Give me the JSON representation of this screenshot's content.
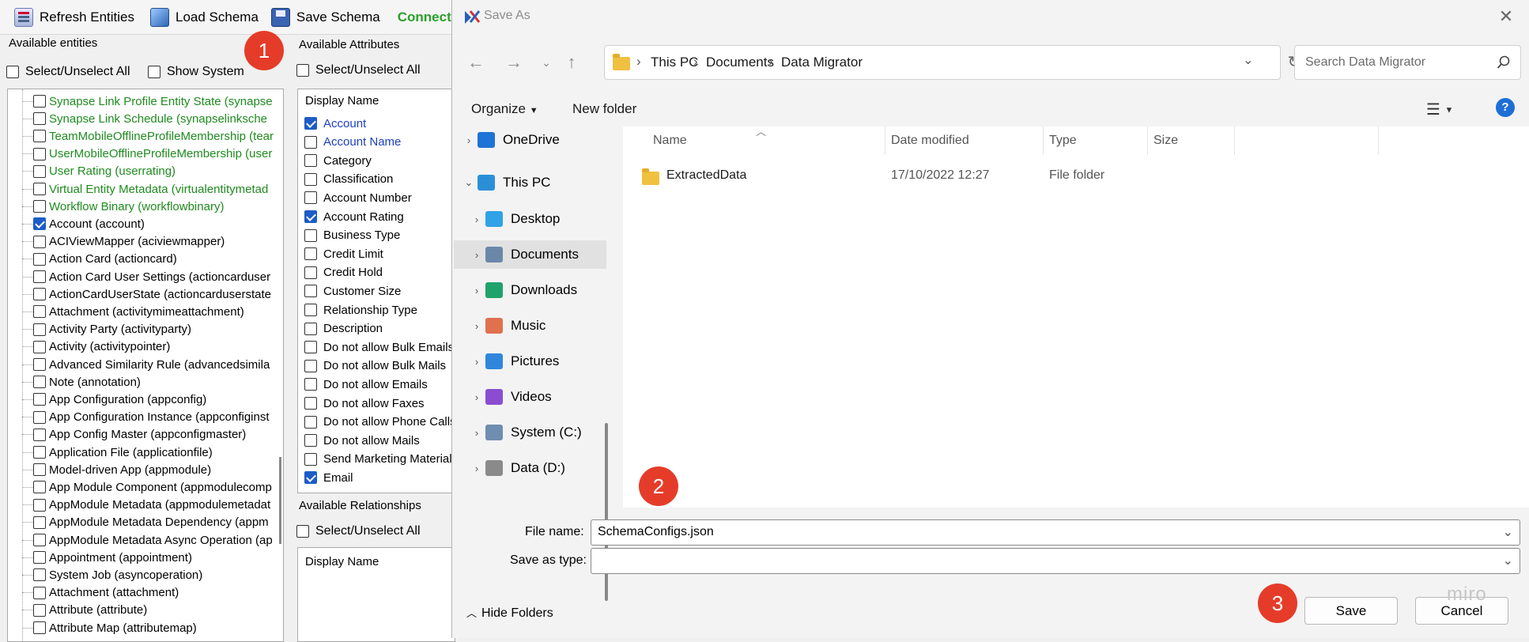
{
  "toolbar": {
    "refresh_label": "Refresh Entities",
    "load_label": "Load Schema",
    "save_label": "Save Schema",
    "status": "Connected"
  },
  "entities": {
    "header": "Available entities",
    "select_all": "Select/Unselect All",
    "show_system": "Show System",
    "items": [
      {
        "label": "Synapse Link Profile Entity State (synapse",
        "green": true,
        "checked": false
      },
      {
        "label": "Synapse Link Schedule (synapselinksche",
        "green": true,
        "checked": false
      },
      {
        "label": "TeamMobileOfflineProfileMembership (tear",
        "green": true,
        "checked": false
      },
      {
        "label": "UserMobileOfflineProfileMembership (user",
        "green": true,
        "checked": false
      },
      {
        "label": "User Rating (userrating)",
        "green": true,
        "checked": false
      },
      {
        "label": "Virtual Entity  Metadata (virtualentitymetad",
        "green": true,
        "checked": false
      },
      {
        "label": "Workflow Binary (workflowbinary)",
        "green": true,
        "checked": false
      },
      {
        "label": "Account (account)",
        "green": false,
        "checked": true
      },
      {
        "label": "ACIViewMapper (aciviewmapper)",
        "green": false,
        "checked": false
      },
      {
        "label": "Action Card (actioncard)",
        "green": false,
        "checked": false
      },
      {
        "label": "Action Card User Settings (actioncarduser",
        "green": false,
        "checked": false
      },
      {
        "label": "ActionCardUserState (actioncarduserstate",
        "green": false,
        "checked": false
      },
      {
        "label": "Attachment (activitymimeattachment)",
        "green": false,
        "checked": false
      },
      {
        "label": "Activity Party (activityparty)",
        "green": false,
        "checked": false
      },
      {
        "label": "Activity (activitypointer)",
        "green": false,
        "checked": false
      },
      {
        "label": "Advanced Similarity Rule (advancedsimila",
        "green": false,
        "checked": false
      },
      {
        "label": "Note (annotation)",
        "green": false,
        "checked": false
      },
      {
        "label": "App Configuration (appconfig)",
        "green": false,
        "checked": false
      },
      {
        "label": "App Configuration Instance (appconfiginst",
        "green": false,
        "checked": false
      },
      {
        "label": "App Config Master (appconfigmaster)",
        "green": false,
        "checked": false
      },
      {
        "label": "Application File (applicationfile)",
        "green": false,
        "checked": false
      },
      {
        "label": "Model-driven App (appmodule)",
        "green": false,
        "checked": false
      },
      {
        "label": "App Module Component (appmodulecomp",
        "green": false,
        "checked": false
      },
      {
        "label": "AppModule Metadata (appmodulemetadat",
        "green": false,
        "checked": false
      },
      {
        "label": "AppModule Metadata Dependency (appm",
        "green": false,
        "checked": false
      },
      {
        "label": "AppModule Metadata Async Operation (ap",
        "green": false,
        "checked": false
      },
      {
        "label": "Appointment (appointment)",
        "green": false,
        "checked": false
      },
      {
        "label": "System Job (asyncoperation)",
        "green": false,
        "checked": false
      },
      {
        "label": "Attachment (attachment)",
        "green": false,
        "checked": false
      },
      {
        "label": "Attribute (attribute)",
        "green": false,
        "checked": false
      },
      {
        "label": "Attribute Map (attributemap)",
        "green": false,
        "checked": false
      }
    ]
  },
  "attributes": {
    "header": "Available Attributes",
    "select_all": "Select/Unselect All",
    "column": "Display Name",
    "items": [
      {
        "label": "Account",
        "checked": true,
        "blue": true
      },
      {
        "label": "Account Name",
        "checked": false,
        "blue": true
      },
      {
        "label": "Category",
        "checked": false,
        "blue": false
      },
      {
        "label": "Classification",
        "checked": false,
        "blue": false
      },
      {
        "label": "Account Number",
        "checked": false,
        "blue": false
      },
      {
        "label": "Account Rating",
        "checked": true,
        "blue": false
      },
      {
        "label": "Business Type",
        "checked": false,
        "blue": false
      },
      {
        "label": "Credit Limit",
        "checked": false,
        "blue": false
      },
      {
        "label": "Credit Hold",
        "checked": false,
        "blue": false
      },
      {
        "label": "Customer Size",
        "checked": false,
        "blue": false
      },
      {
        "label": "Relationship Type",
        "checked": false,
        "blue": false
      },
      {
        "label": "Description",
        "checked": false,
        "blue": false
      },
      {
        "label": "Do not allow Bulk Emails",
        "checked": false,
        "blue": false
      },
      {
        "label": "Do not allow Bulk Mails",
        "checked": false,
        "blue": false
      },
      {
        "label": "Do not allow Emails",
        "checked": false,
        "blue": false
      },
      {
        "label": "Do not allow Faxes",
        "checked": false,
        "blue": false
      },
      {
        "label": "Do not allow Phone Calls",
        "checked": false,
        "blue": false
      },
      {
        "label": "Do not allow Mails",
        "checked": false,
        "blue": false
      },
      {
        "label": "Send Marketing Materials",
        "checked": false,
        "blue": false
      },
      {
        "label": "Email",
        "checked": true,
        "blue": false
      }
    ]
  },
  "relationships": {
    "header": "Available Relationships",
    "select_all": "Select/Unselect All",
    "column": "Display Name"
  },
  "badges": {
    "one": "1",
    "two": "2",
    "three": "3"
  },
  "dialog": {
    "title": "Save As",
    "breadcrumb": [
      "This PC",
      "Documents",
      "Data Migrator"
    ],
    "search_placeholder": "Search Data Migrator",
    "organize": "Organize",
    "new_folder": "New folder",
    "nav": [
      {
        "label": "OneDrive",
        "icon": "cloud-icon",
        "color": "#1e73d6"
      },
      {
        "label": "This PC",
        "icon": "computer-icon",
        "color": "#2b8fd8"
      },
      {
        "label": "Desktop",
        "icon": "desktop-icon",
        "color": "#2fa3e6"
      },
      {
        "label": "Documents",
        "icon": "documents-icon",
        "color": "#6b87a8"
      },
      {
        "label": "Downloads",
        "icon": "download-icon",
        "color": "#1fa36b"
      },
      {
        "label": "Music",
        "icon": "music-icon",
        "color": "#e0704e"
      },
      {
        "label": "Pictures",
        "icon": "pictures-icon",
        "color": "#2f86dd"
      },
      {
        "label": "Videos",
        "icon": "videos-icon",
        "color": "#8a4dd1"
      },
      {
        "label": "System (C:)",
        "icon": "drive-icon",
        "color": "#6e8db0"
      },
      {
        "label": "Data (D:)",
        "icon": "drive-icon",
        "color": "#8a8a8a"
      }
    ],
    "columns": {
      "name": "Name",
      "date": "Date modified",
      "type": "Type",
      "size": "Size"
    },
    "files": [
      {
        "name": "ExtractedData",
        "date": "17/10/2022 12:27",
        "type": "File folder"
      }
    ],
    "file_name_label": "File name:",
    "file_name_value": "SchemaConfigs.json",
    "save_type_label": "Save as type:",
    "hide_folders": "Hide Folders",
    "save": "Save",
    "cancel": "Cancel",
    "watermark": "miro"
  }
}
